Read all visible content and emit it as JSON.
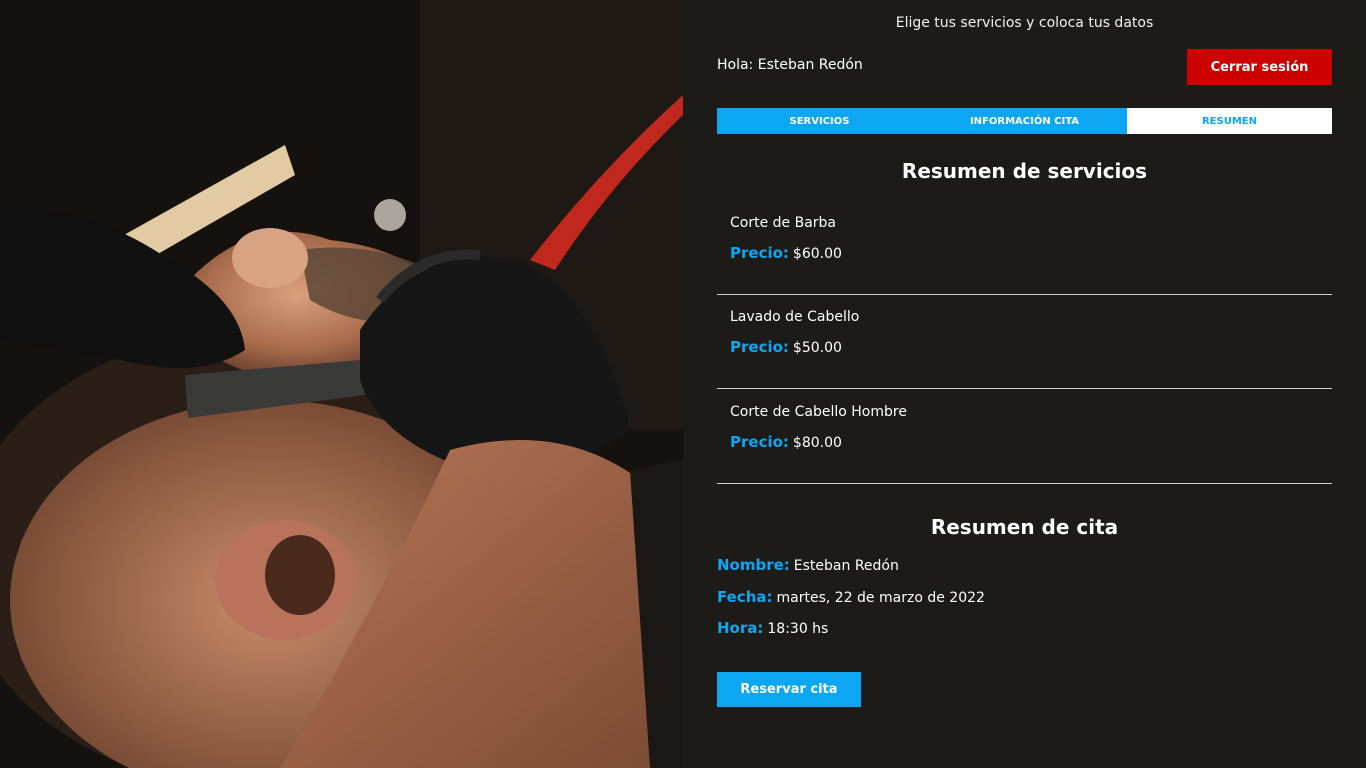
{
  "header": {
    "subtitle": "Elige tus servicios y coloca tus datos",
    "greeting_label": "Hola:",
    "user_name": "Esteban Redón",
    "logout_label": "Cerrar sesión"
  },
  "tabs": [
    {
      "label": "Servicios"
    },
    {
      "label": "Información Cita"
    },
    {
      "label": "Resumen"
    }
  ],
  "services_summary": {
    "title": "Resumen de servicios",
    "price_label": "Precio:",
    "items": [
      {
        "name": "Corte de Barba",
        "price": "$60.00"
      },
      {
        "name": "Lavado de Cabello",
        "price": "$50.00"
      },
      {
        "name": "Corte de Cabello Hombre",
        "price": "$80.00"
      }
    ]
  },
  "appointment_summary": {
    "title": "Resumen de cita",
    "name_label": "Nombre:",
    "name_value": "Esteban Redón",
    "date_label": "Fecha:",
    "date_value": "martes, 22 de marzo de 2022",
    "time_label": "Hora:",
    "time_value": "18:30 hs"
  },
  "actions": {
    "reserve_label": "Reservar cita"
  },
  "colors": {
    "accent": "#0da6f2",
    "danger": "#cc0000",
    "background": "#1c1b18"
  },
  "hero_image": {
    "icon": "barber-shaving-photo"
  }
}
